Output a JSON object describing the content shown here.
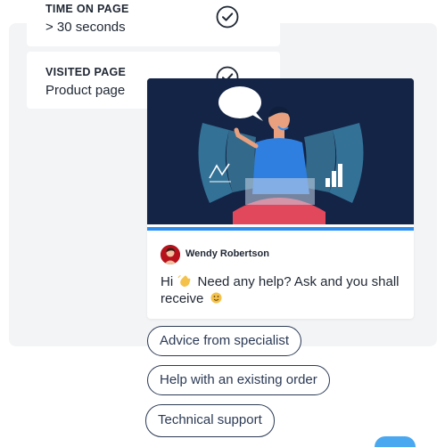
{
  "rules": [
    {
      "title": "TIME ON PAGE",
      "value": "> 30 seconds",
      "icon": "check-circle-icon"
    },
    {
      "title": "VISITED PAGE",
      "value": "Product page",
      "icon": "check-circle-icon"
    }
  ],
  "chat": {
    "agent_name": "Wendy Robertson",
    "message_before_wave": "Hi",
    "message_after_wave": "Need any help? Ask and you shall receive",
    "wave_icon": "waving-hand-icon",
    "smile_icon": "smiling-face-icon"
  },
  "quick_replies": [
    "Advice from specialist",
    "Help with an existing order",
    "Technical support"
  ],
  "colors": {
    "illustration_bg": "#132446",
    "accent": "#2e8ff0",
    "panel_bg": "#f3f4f6",
    "button_border": "#2b3a55"
  }
}
